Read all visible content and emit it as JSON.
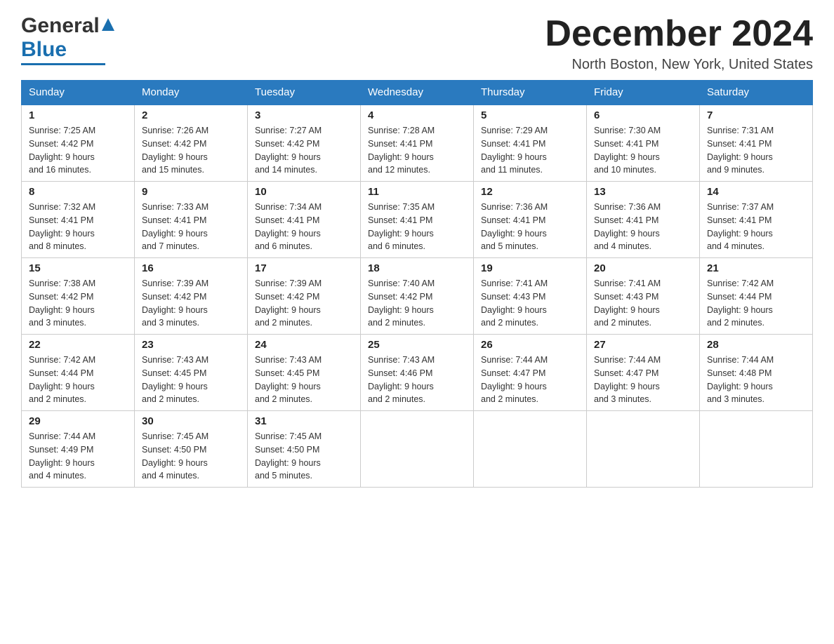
{
  "logo": {
    "general": "General",
    "blue": "Blue"
  },
  "title": "December 2024",
  "location": "North Boston, New York, United States",
  "days_of_week": [
    "Sunday",
    "Monday",
    "Tuesday",
    "Wednesday",
    "Thursday",
    "Friday",
    "Saturday"
  ],
  "weeks": [
    [
      {
        "day": "1",
        "sunrise": "7:25 AM",
        "sunset": "4:42 PM",
        "daylight": "9 hours and 16 minutes."
      },
      {
        "day": "2",
        "sunrise": "7:26 AM",
        "sunset": "4:42 PM",
        "daylight": "9 hours and 15 minutes."
      },
      {
        "day": "3",
        "sunrise": "7:27 AM",
        "sunset": "4:42 PM",
        "daylight": "9 hours and 14 minutes."
      },
      {
        "day": "4",
        "sunrise": "7:28 AM",
        "sunset": "4:41 PM",
        "daylight": "9 hours and 12 minutes."
      },
      {
        "day": "5",
        "sunrise": "7:29 AM",
        "sunset": "4:41 PM",
        "daylight": "9 hours and 11 minutes."
      },
      {
        "day": "6",
        "sunrise": "7:30 AM",
        "sunset": "4:41 PM",
        "daylight": "9 hours and 10 minutes."
      },
      {
        "day": "7",
        "sunrise": "7:31 AM",
        "sunset": "4:41 PM",
        "daylight": "9 hours and 9 minutes."
      }
    ],
    [
      {
        "day": "8",
        "sunrise": "7:32 AM",
        "sunset": "4:41 PM",
        "daylight": "9 hours and 8 minutes."
      },
      {
        "day": "9",
        "sunrise": "7:33 AM",
        "sunset": "4:41 PM",
        "daylight": "9 hours and 7 minutes."
      },
      {
        "day": "10",
        "sunrise": "7:34 AM",
        "sunset": "4:41 PM",
        "daylight": "9 hours and 6 minutes."
      },
      {
        "day": "11",
        "sunrise": "7:35 AM",
        "sunset": "4:41 PM",
        "daylight": "9 hours and 6 minutes."
      },
      {
        "day": "12",
        "sunrise": "7:36 AM",
        "sunset": "4:41 PM",
        "daylight": "9 hours and 5 minutes."
      },
      {
        "day": "13",
        "sunrise": "7:36 AM",
        "sunset": "4:41 PM",
        "daylight": "9 hours and 4 minutes."
      },
      {
        "day": "14",
        "sunrise": "7:37 AM",
        "sunset": "4:41 PM",
        "daylight": "9 hours and 4 minutes."
      }
    ],
    [
      {
        "day": "15",
        "sunrise": "7:38 AM",
        "sunset": "4:42 PM",
        "daylight": "9 hours and 3 minutes."
      },
      {
        "day": "16",
        "sunrise": "7:39 AM",
        "sunset": "4:42 PM",
        "daylight": "9 hours and 3 minutes."
      },
      {
        "day": "17",
        "sunrise": "7:39 AM",
        "sunset": "4:42 PM",
        "daylight": "9 hours and 2 minutes."
      },
      {
        "day": "18",
        "sunrise": "7:40 AM",
        "sunset": "4:42 PM",
        "daylight": "9 hours and 2 minutes."
      },
      {
        "day": "19",
        "sunrise": "7:41 AM",
        "sunset": "4:43 PM",
        "daylight": "9 hours and 2 minutes."
      },
      {
        "day": "20",
        "sunrise": "7:41 AM",
        "sunset": "4:43 PM",
        "daylight": "9 hours and 2 minutes."
      },
      {
        "day": "21",
        "sunrise": "7:42 AM",
        "sunset": "4:44 PM",
        "daylight": "9 hours and 2 minutes."
      }
    ],
    [
      {
        "day": "22",
        "sunrise": "7:42 AM",
        "sunset": "4:44 PM",
        "daylight": "9 hours and 2 minutes."
      },
      {
        "day": "23",
        "sunrise": "7:43 AM",
        "sunset": "4:45 PM",
        "daylight": "9 hours and 2 minutes."
      },
      {
        "day": "24",
        "sunrise": "7:43 AM",
        "sunset": "4:45 PM",
        "daylight": "9 hours and 2 minutes."
      },
      {
        "day": "25",
        "sunrise": "7:43 AM",
        "sunset": "4:46 PM",
        "daylight": "9 hours and 2 minutes."
      },
      {
        "day": "26",
        "sunrise": "7:44 AM",
        "sunset": "4:47 PM",
        "daylight": "9 hours and 2 minutes."
      },
      {
        "day": "27",
        "sunrise": "7:44 AM",
        "sunset": "4:47 PM",
        "daylight": "9 hours and 3 minutes."
      },
      {
        "day": "28",
        "sunrise": "7:44 AM",
        "sunset": "4:48 PM",
        "daylight": "9 hours and 3 minutes."
      }
    ],
    [
      {
        "day": "29",
        "sunrise": "7:44 AM",
        "sunset": "4:49 PM",
        "daylight": "9 hours and 4 minutes."
      },
      {
        "day": "30",
        "sunrise": "7:45 AM",
        "sunset": "4:50 PM",
        "daylight": "9 hours and 4 minutes."
      },
      {
        "day": "31",
        "sunrise": "7:45 AM",
        "sunset": "4:50 PM",
        "daylight": "9 hours and 5 minutes."
      },
      null,
      null,
      null,
      null
    ]
  ],
  "labels": {
    "sunrise": "Sunrise:",
    "sunset": "Sunset:",
    "daylight": "Daylight:"
  }
}
